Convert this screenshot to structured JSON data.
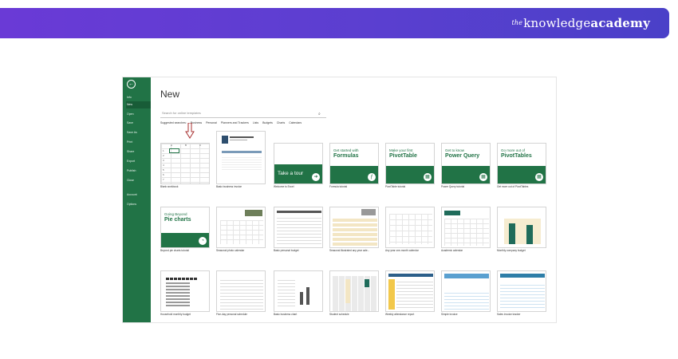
{
  "brand": {
    "prefix": "the",
    "name": "knowledge",
    "bold": "academy"
  },
  "excel": {
    "rail": [
      "Info",
      "New",
      "Open",
      "Save",
      "Save As",
      "Print",
      "Share",
      "Export",
      "Publish",
      "Close",
      "Account",
      "Options"
    ],
    "active_rail": "New",
    "title": "New",
    "search_placeholder": "Search for online templates",
    "suggested_label": "Suggested searches:",
    "suggested": [
      "Business",
      "Personal",
      "Planners and Trackers",
      "Lists",
      "Budgets",
      "Charts",
      "Calendars"
    ],
    "row1": [
      {
        "caption": "Blank workbook"
      },
      {
        "caption": "Basic business invoice"
      },
      {
        "caption": "Welcome to Excel",
        "top": "",
        "main": "Take a tour",
        "icon": "arrow-icon"
      },
      {
        "caption": "Formula tutorial",
        "top": "Get started with",
        "main": "Formulas",
        "icon": "fx-icon"
      },
      {
        "caption": "PivotTable tutorial",
        "top": "Make your first",
        "main": "PivotTable",
        "icon": "table-icon"
      },
      {
        "caption": "Power Query tutorial",
        "top": "Get to know",
        "main": "Power Query",
        "icon": "table-icon"
      },
      {
        "caption": "Get more out of PivotTables",
        "top": "Go more out of",
        "main": "PivotTables",
        "icon": "table-icon"
      }
    ],
    "row2": [
      {
        "caption": "Beyond pie charts tutorial",
        "top": "Going Beyond",
        "main": "Pie charts"
      },
      {
        "caption": "Seasonal photo calendar"
      },
      {
        "caption": "Basic personal budget"
      },
      {
        "caption": "Seasonal illustrated any year cale..."
      },
      {
        "caption": "Any year one-month calendar"
      },
      {
        "caption": "Academic calendar"
      },
      {
        "caption": "Monthly company budget"
      }
    ],
    "row3": [
      {
        "caption": "Household monthly budget"
      },
      {
        "caption": "Five-day personal schedule"
      },
      {
        "caption": "Basic business chart"
      },
      {
        "caption": "Student schedule"
      },
      {
        "caption": "Weekly attendance report"
      },
      {
        "caption": "Simple invoice"
      },
      {
        "caption": "Sales invoice tracker"
      }
    ],
    "sheet_cols": [
      "A",
      "B",
      "C"
    ],
    "sheet_rows": [
      "1",
      "2",
      "3",
      "4",
      "5",
      "6",
      "7"
    ]
  },
  "colors": {
    "excel_green": "#217346",
    "banner": "#5b3fd0",
    "arrow": "#a83232"
  }
}
